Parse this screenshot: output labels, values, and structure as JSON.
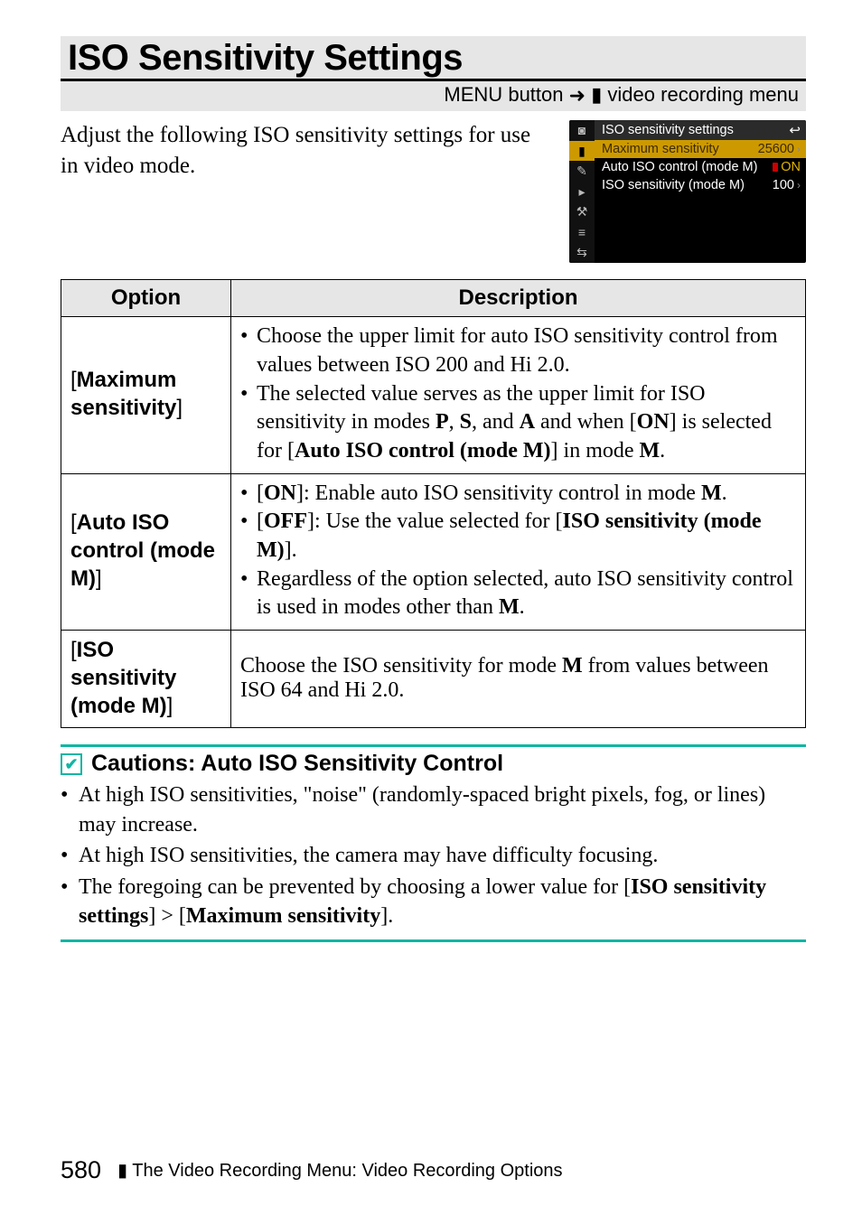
{
  "title": "ISO Sensitivity Settings",
  "breadcrumb": {
    "menu_label": "MENU",
    "button_word": "button",
    "arrow": "➜",
    "dest": "video recording menu"
  },
  "intro": "Adjust the following ISO sensitivity settings for use in video mode.",
  "camera_menu": {
    "title": "ISO sensitivity settings",
    "return_glyph": "↩",
    "side_icons": [
      "◙",
      "▮",
      "✎",
      "▸",
      "⚒",
      "≡",
      "⇆"
    ],
    "rows": [
      {
        "label": "Maximum sensitivity",
        "value": "25600",
        "selected": true,
        "indicator": ""
      },
      {
        "label": "Auto ISO control (mode M)",
        "value": "ON",
        "selected": false,
        "indicator": "rec"
      },
      {
        "label": "ISO sensitivity (mode M)",
        "value": "100",
        "selected": false,
        "indicator": ""
      }
    ]
  },
  "table": {
    "headers": [
      "Option",
      "Description"
    ],
    "rows": [
      {
        "option_pre": "[",
        "option_bold": "Maximum sensitivity",
        "option_post": "]",
        "desc": [
          {
            "type": "plain",
            "text": "Choose the upper limit for auto ISO sensitivity control from values between ISO 200 and Hi 2.0."
          },
          {
            "type": "rich2",
            "a": "The selected value serves as the upper limit for ISO sensitivity in modes ",
            "b1": "P",
            "c1": ", ",
            "b2": "S",
            "c2": ", and ",
            "b3": "A",
            "c3": " and when [",
            "b4": "ON",
            "c4": "] is selected for [",
            "b5": "Auto ISO control (mode M)",
            "c5": "] in mode ",
            "b6": "M",
            "c6": "."
          }
        ]
      },
      {
        "option_pre": "[",
        "option_bold": "Auto ISO control (mode M)",
        "option_post": "]",
        "desc": [
          {
            "type": "rich3",
            "a": "[",
            "b1": "ON",
            "c1": "]: Enable auto ISO sensitivity control in mode ",
            "b2": "M",
            "c2": "."
          },
          {
            "type": "rich3b",
            "a": "[",
            "b1": "OFF",
            "c1": "]: Use the value selected for [",
            "b2": "ISO sensitivity (mode M)",
            "c2": "]."
          },
          {
            "type": "rich3c",
            "a": "Regardless of the option selected, auto ISO sensitivity control is used in modes other than ",
            "b1": "M",
            "c1": "."
          }
        ]
      },
      {
        "option_pre": "[",
        "option_bold": "ISO sensitivity (mode M)",
        "option_post": "]",
        "desc_plain_rich": {
          "a": "Choose the ISO sensitivity for mode ",
          "b": "M",
          "c": " from values between ISO 64 and Hi 2.0."
        }
      }
    ]
  },
  "cautions": {
    "heading": "Cautions: Auto ISO Sensitivity Control",
    "items": [
      {
        "type": "plain",
        "text": "At high ISO sensitivities, \"noise\" (randomly-spaced bright pixels, fog, or lines) may increase."
      },
      {
        "type": "plain",
        "text": "At high ISO sensitivities, the camera may have difficulty focusing."
      },
      {
        "type": "rich",
        "a": "The foregoing can be prevented by choosing a lower value for [",
        "b1": "ISO sensitivity settings",
        "c1": "] > [",
        "b2": "Maximum sensitivity",
        "c2": "]."
      }
    ]
  },
  "footer": {
    "page": "580",
    "section_icon": "▮",
    "section": "The Video Recording Menu: Video Recording Options"
  }
}
